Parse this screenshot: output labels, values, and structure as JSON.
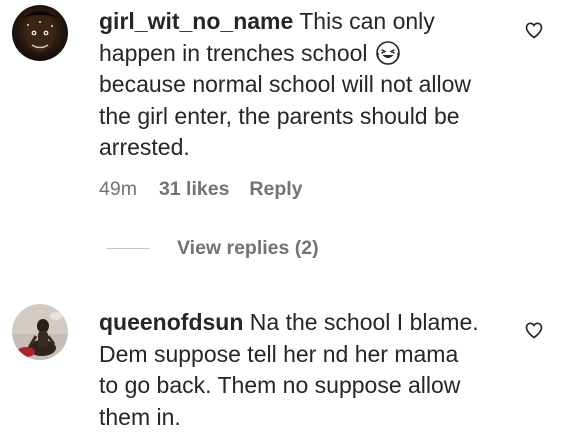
{
  "comments": [
    {
      "username": "girl_wit_no_name",
      "text": " This can only happen in trenches school",
      "emoji": "grinning-squinting-face-with-tears-of-joy",
      "text_after_emoji": " because normal school will not allow the girl enter, the parents should be arrested.",
      "time": "49m",
      "likes": "31 likes",
      "reply_label": "Reply",
      "view_replies": "View replies (2)",
      "like_icon": "heart-outline-icon"
    },
    {
      "username": "queenofdsun",
      "text": " Na the school I blame. Dem suppose tell her nd her mama to go back. Them no suppose allow them in.",
      "like_icon": "heart-outline-icon"
    }
  ],
  "colors": {
    "primary_text": "#262626",
    "secondary_text": "#737373",
    "divider": "#c7c7c7",
    "background": "#ffffff"
  }
}
